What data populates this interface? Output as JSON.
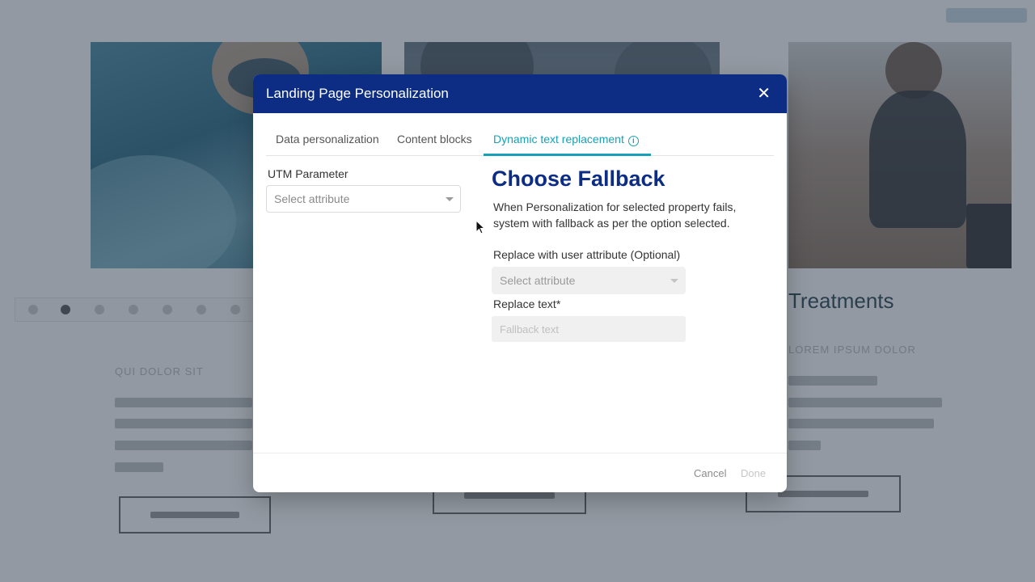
{
  "modal": {
    "title": "Landing Page Personalization",
    "close_icon": "close-icon",
    "tabs": [
      {
        "label": "Data personalization",
        "active": false
      },
      {
        "label": "Content blocks",
        "active": false
      },
      {
        "label": "Dynamic text replacement",
        "active": true
      }
    ],
    "tab_info_icon": "info-icon",
    "utm": {
      "label": "UTM Parameter",
      "select_placeholder": "Select attribute"
    },
    "fallback": {
      "heading": "Choose Fallback",
      "description": "When Personalization for selected property fails, system with fallback as per the option selected.",
      "user_attribute_label": "Replace with user attribute (Optional)",
      "user_attribute_placeholder": "Select attribute",
      "replace_text_label": "Replace text*",
      "replace_text_placeholder": "Fallback text"
    },
    "footer": {
      "cancel_label": "Cancel",
      "done_label": "Done"
    }
  },
  "colors": {
    "header_bg": "#0c2d83",
    "accent_teal": "#1aa0b6",
    "heading_blue": "#0c2d83",
    "overlay": "rgba(40,52,70,0.5)"
  }
}
